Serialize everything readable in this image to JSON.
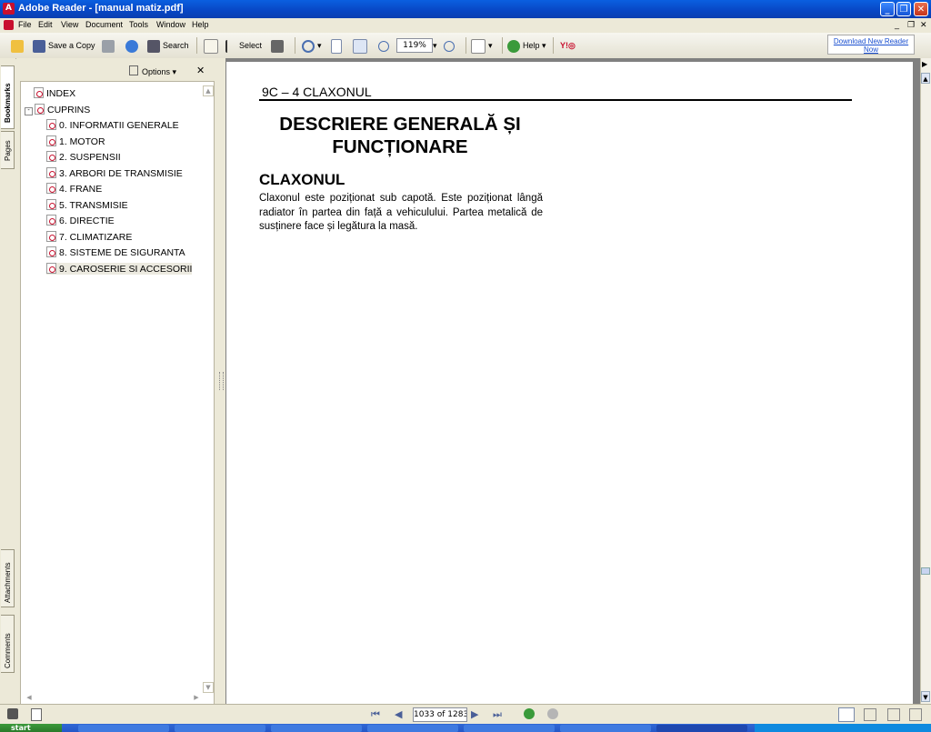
{
  "window": {
    "title": "Adobe Reader - [manual matiz.pdf]"
  },
  "menu": [
    "File",
    "Edit",
    "View",
    "Document",
    "Tools",
    "Window",
    "Help"
  ],
  "toolbar": {
    "save_copy": "Save a Copy",
    "search": "Search",
    "select": "Select",
    "zoom": "119%",
    "help": "Help",
    "download_line1": "Download New Reader",
    "download_line2": "Now"
  },
  "side_tabs": {
    "bookmarks": "Bookmarks",
    "pages": "Pages",
    "attachments": "Attachments",
    "comments": "Comments"
  },
  "panel": {
    "options": "Options",
    "root_items": [
      "INDEX",
      "CUPRINS"
    ],
    "children": [
      "0. INFORMATII GENERALE",
      "1. MOTOR",
      "2. SUSPENSII",
      "3. ARBORI DE TRANSMISIE",
      "4. FRANE",
      "5. TRANSMISIE",
      "6. DIRECTIE",
      "7. CLIMATIZARE",
      "8. SISTEME DE SIGURANTA",
      "9. CAROSERIE SI ACCESORII"
    ],
    "selected_index": 9
  },
  "document": {
    "header": "9C – 4  CLAXONUL",
    "title_line1": "DESCRIERE GENERALĂ ȘI",
    "title_line2": "FUNCȚIONARE",
    "section": "CLAXONUL",
    "body": "Claxonul este poziționat sub capotă. Este poziționat lângă radiator în partea din față a vehiculului. Partea metalică de susținere face și legătura la masă."
  },
  "status": {
    "page_indicator": "1033 of 1283"
  },
  "taskbar": {
    "start": "start"
  }
}
